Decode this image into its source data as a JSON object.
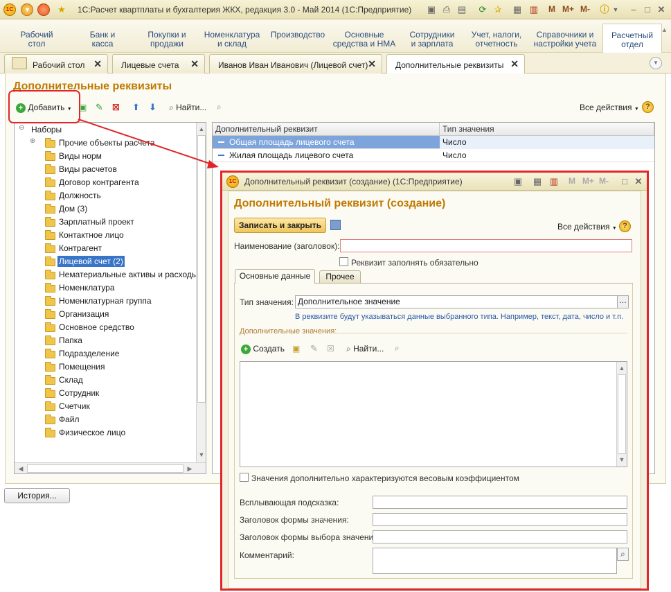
{
  "window": {
    "title": "1С:Расчет квартплаты и бухгалтерия ЖКХ, редакция 3.0 - Май 2014  (1С:Предприятие)",
    "logo": "1С",
    "m_buttons": [
      "M",
      "M+",
      "M-"
    ]
  },
  "sections": [
    {
      "label": "Рабочий\nстол"
    },
    {
      "label": "Банк и\nкасса"
    },
    {
      "label": "Покупки и\nпродажи"
    },
    {
      "label": "Номенклатура\nи склад"
    },
    {
      "label": "Производство"
    },
    {
      "label": "Основные\nсредства и НМА"
    },
    {
      "label": "Сотрудники\nи зарплата"
    },
    {
      "label": "Учет, налоги,\nотчетность"
    },
    {
      "label": "Справочники и\nнастройки учета"
    },
    {
      "label": "Расчетный\nотдел"
    }
  ],
  "open_tabs": [
    {
      "label": "Рабочий стол"
    },
    {
      "label": "Лицевые счета"
    },
    {
      "label": "Иванов Иван Иванович (Лицевой счет)"
    },
    {
      "label": "Дополнительные реквизиты"
    }
  ],
  "main": {
    "title": "Дополнительные реквизиты",
    "toolbar": {
      "add_label": "Добавить",
      "find_label": "Найти...",
      "all_actions_label": "Все действия"
    },
    "tree": {
      "root": "Наборы",
      "items": [
        "Прочие объекты расчета",
        "Виды норм",
        "Виды расчетов",
        "Договор контрагента",
        "Должность",
        "Дом (3)",
        "Зарплатный проект",
        "Контактное лицо",
        "Контрагент",
        "Лицевой счет (2)",
        "Нематериальные активы и расходы...",
        "Номенклатура",
        "Номенклатурная группа",
        "Организация",
        "Основное средство",
        "Папка",
        "Подразделение",
        "Помещения",
        "Склад",
        "Сотрудник",
        "Счетчик",
        "Файл",
        "Физическое лицо"
      ],
      "selected_index": 9
    },
    "table": {
      "columns": [
        "Дополнительный реквизит",
        "Тип значения"
      ],
      "rows": [
        {
          "name": "Общая площадь лицевого счета",
          "type": "Число"
        },
        {
          "name": "Жилая площадь лицевого счета",
          "type": "Число"
        }
      ]
    },
    "history_label": "История..."
  },
  "dialog": {
    "title": "Дополнительный реквизит (создание)  (1С:Предприятие)",
    "heading": "Дополнительный реквизит (создание)",
    "save_close_label": "Записать и закрыть",
    "all_actions_label": "Все действия",
    "name_label": "Наименование (заголовок):",
    "name_value": "",
    "required_label": "Реквизит заполнять обязательно",
    "tabs": [
      "Основные данные",
      "Прочее"
    ],
    "value_type_label": "Тип значения:",
    "value_type_value": "Дополнительное значение",
    "value_type_hint": "В реквизите будут указываться данные выбранного типа. Например, текст, дата, число и т.п.",
    "additional_values_label": "Дополнительные значения:",
    "create_label": "Создать",
    "find_label": "Найти...",
    "weight_label": "Значения дополнительно характеризуются весовым коэффициентом",
    "tooltip_label": "Всплывающая подсказка:",
    "value_form_header_label": "Заголовок формы значения:",
    "value_choice_header_label": "Заголовок формы выбора значения:",
    "comment_label": "Комментарий:"
  },
  "colors": {
    "accent_title": "#c07a00",
    "highlight_red": "#e0262a",
    "selection": "#3874c8"
  }
}
